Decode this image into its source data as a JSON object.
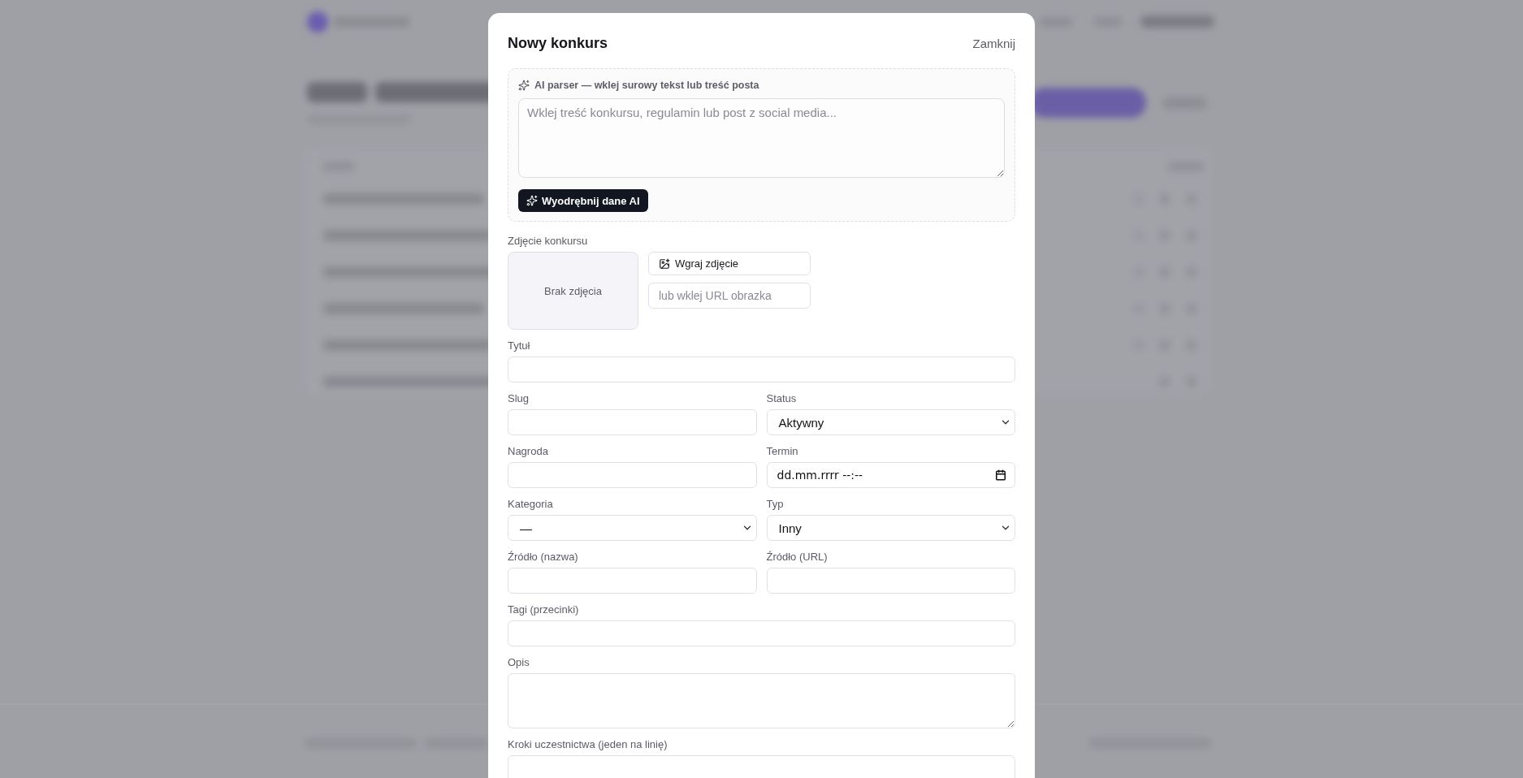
{
  "modal": {
    "title": "Nowy konkurs",
    "close_label": "Zamknij"
  },
  "ai_parser": {
    "label": "AI parser — wklej surowy tekst lub treść posta",
    "placeholder": "Wklej treść konkursu, regulamin lub post z social media...",
    "button": "Wyodrębnij dane AI"
  },
  "photo": {
    "label": "Zdjęcie konkursu",
    "empty_text": "Brak zdjęcia",
    "upload_button": "Wgraj zdjęcie",
    "url_placeholder": "lub wklej URL obrazka"
  },
  "field_rows": [
    [
      {
        "kind": "text",
        "label": "Tytuł"
      }
    ],
    [
      {
        "kind": "text",
        "label": "Slug"
      },
      {
        "kind": "select",
        "label": "Status",
        "value": "Aktywny"
      }
    ],
    [
      {
        "kind": "text",
        "label": "Nagroda"
      },
      {
        "kind": "date",
        "label": "Termin",
        "placeholder": "dd.mm.rrrr --:--"
      }
    ],
    [
      {
        "kind": "select",
        "label": "Kategoria",
        "value": "—"
      },
      {
        "kind": "select",
        "label": "Typ",
        "value": "Inny"
      }
    ],
    [
      {
        "kind": "text",
        "label": "Źródło (nazwa)"
      },
      {
        "kind": "text",
        "label": "Źródło (URL)"
      }
    ],
    [
      {
        "kind": "text",
        "label": "Tagi (przecinki)"
      }
    ],
    [
      {
        "kind": "textarea",
        "label": "Opis"
      }
    ],
    [
      {
        "kind": "textarea",
        "label": "Kroki uczestnictwa (jeden na linię)"
      }
    ]
  ]
}
